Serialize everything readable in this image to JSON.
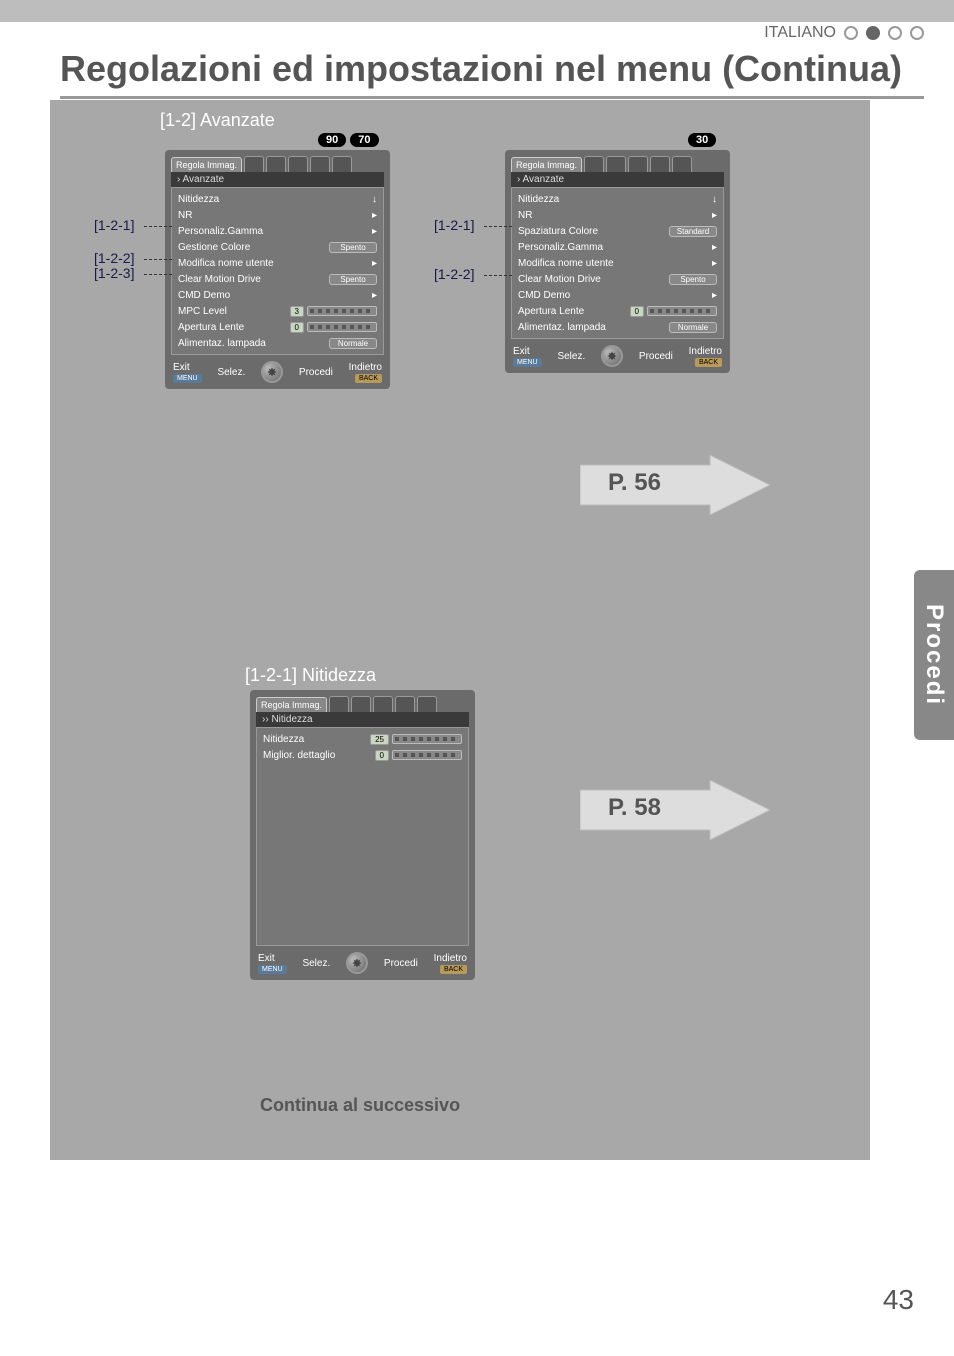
{
  "header": {
    "language": "ITALIANO",
    "title": "Regolazioni ed impostazioni nel menu (Continua)"
  },
  "sideTab": "Procedi",
  "pageNumber": "43",
  "continueText": "Continua al successivo",
  "arrows": {
    "p56": "P. 56",
    "p58": "P. 58"
  },
  "panelA": {
    "title": "[1-2] Avanzate",
    "badges": [
      "90",
      "70"
    ],
    "tabSelected": "Regola Immag.",
    "breadcrumb": "› Avanzate",
    "callouts": {
      "c1": "[1-2-1]",
      "c2": "[1-2-2]",
      "c3": "[1-2-3]"
    },
    "rows": [
      {
        "label": "Nitidezza",
        "type": "down"
      },
      {
        "label": "NR",
        "type": "arrow"
      },
      {
        "label": "Personaliz.Gamma",
        "type": "arrow"
      },
      {
        "label": "Gestione Colore",
        "type": "pill",
        "value": "Spento"
      },
      {
        "label": "Modifica nome utente",
        "type": "arrow"
      },
      {
        "label": "Clear Motion Drive",
        "type": "pill",
        "value": "Spento"
      },
      {
        "label": "CMD Demo",
        "type": "arrow"
      },
      {
        "label": "MPC Level",
        "type": "valslider",
        "value": "3"
      },
      {
        "label": "Apertura Lente",
        "type": "valslider",
        "value": "0"
      },
      {
        "label": "Alimentaz. lampada",
        "type": "pill",
        "value": "Normale"
      }
    ],
    "footer": {
      "exit": "Exit",
      "menu": "MENU",
      "selez": "Selez.",
      "procedi": "Procedi",
      "indietro": "Indietro",
      "back": "BACK"
    }
  },
  "panelB": {
    "badges": [
      "30"
    ],
    "tabSelected": "Regola Immag.",
    "breadcrumb": "› Avanzate",
    "callouts": {
      "c1": "[1-2-1]",
      "c2": "[1-2-2]"
    },
    "rows": [
      {
        "label": "Nitidezza",
        "type": "down"
      },
      {
        "label": "NR",
        "type": "arrow"
      },
      {
        "label": "Spaziatura Colore",
        "type": "pill",
        "value": "Standard"
      },
      {
        "label": "Personaliz.Gamma",
        "type": "arrow"
      },
      {
        "label": "Modifica nome utente",
        "type": "arrow"
      },
      {
        "label": "Clear Motion Drive",
        "type": "pill",
        "value": "Spento"
      },
      {
        "label": "CMD Demo",
        "type": "arrow"
      },
      {
        "label": "Apertura Lente",
        "type": "valslider",
        "value": "0"
      },
      {
        "label": "Alimentaz. lampada",
        "type": "pill",
        "value": "Normale"
      }
    ],
    "footer": {
      "exit": "Exit",
      "menu": "MENU",
      "selez": "Selez.",
      "procedi": "Procedi",
      "indietro": "Indietro",
      "back": "BACK"
    }
  },
  "panelC": {
    "title": "[1-2-1] Nitidezza",
    "tabSelected": "Regola Immag.",
    "breadcrumb": "›› Nitidezza",
    "rows": [
      {
        "label": "Nitidezza",
        "type": "valslider",
        "value": "25"
      },
      {
        "label": "Miglior. dettaglio",
        "type": "valslider",
        "value": "0"
      }
    ],
    "footer": {
      "exit": "Exit",
      "menu": "MENU",
      "selez": "Selez.",
      "procedi": "Procedi",
      "indietro": "Indietro",
      "back": "BACK"
    }
  }
}
